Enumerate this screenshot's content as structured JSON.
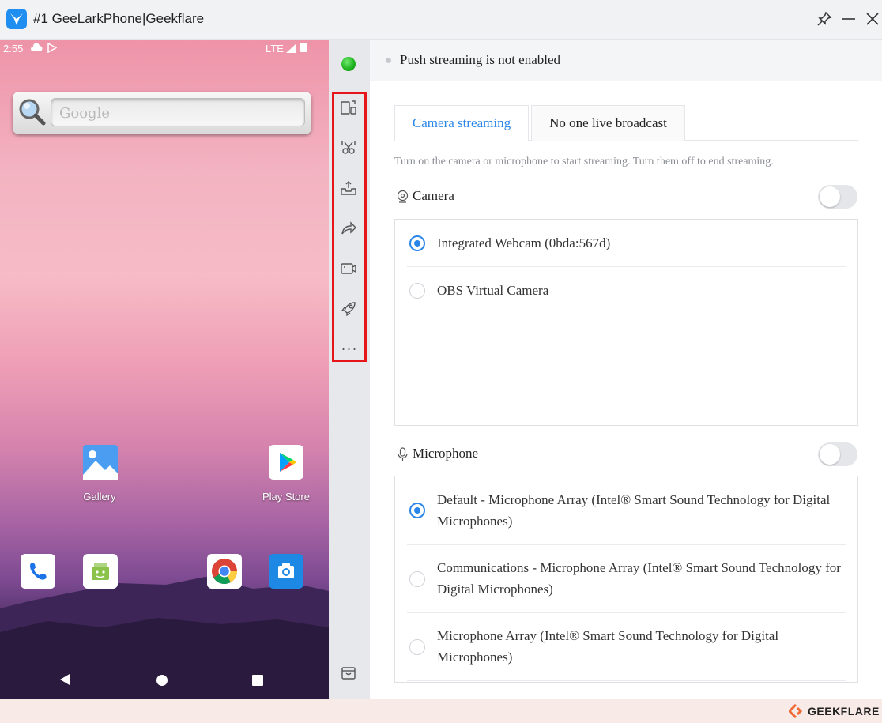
{
  "window": {
    "title": "#1 GeeLarkPhone|Geekflare",
    "controls": [
      "pin-icon",
      "minimize-icon",
      "close-icon"
    ]
  },
  "phone": {
    "status": {
      "time": "2:55",
      "network": "LTE"
    },
    "search_widget": {
      "placeholder": "Google"
    },
    "apps": [
      {
        "label": "Gallery",
        "icon": "gallery-icon"
      },
      {
        "label": "Play Store",
        "icon": "play-store-icon"
      }
    ],
    "dock": [
      "phone-icon",
      "messages-icon",
      "chrome-icon",
      "camera-icon"
    ],
    "nav": [
      "back-icon",
      "home-icon",
      "recents-icon"
    ]
  },
  "toolbar": {
    "status": "online",
    "status_color": "#1db01d",
    "tools": [
      "rotate-screen-icon",
      "screenshot-icon",
      "upload-icon",
      "share-icon",
      "camera-streaming-icon",
      "rocket-icon"
    ],
    "more_label": "···",
    "bottom_tool": "shop-icon",
    "highlight_color": "#e5151a"
  },
  "panel": {
    "push_status": "Push streaming is not enabled",
    "tabs": [
      {
        "label": "Camera streaming",
        "active": true
      },
      {
        "label": "No one live broadcast",
        "active": false
      }
    ],
    "hint": "Turn on the camera or microphone to start streaming. Turn them off to end streaming.",
    "camera": {
      "label": "Camera",
      "enabled": false,
      "devices": [
        {
          "name": "Integrated Webcam (0bda:567d)",
          "selected": true
        },
        {
          "name": "OBS Virtual Camera",
          "selected": false
        }
      ]
    },
    "microphone": {
      "label": "Microphone",
      "enabled": false,
      "devices": [
        {
          "name": "Default - Microphone Array (Intel® Smart Sound Technology for Digital Microphones)",
          "selected": true
        },
        {
          "name": "Communications - Microphone Array (Intel® Smart Sound Technology for Digital Microphones)",
          "selected": false
        },
        {
          "name": "Microphone Array (Intel® Smart Sound Technology for Digital Microphones)",
          "selected": false
        }
      ]
    },
    "accent_color": "#2a86e8"
  },
  "footer": {
    "brand": "GEEKFLARE",
    "brand_color": "#f06a35"
  }
}
